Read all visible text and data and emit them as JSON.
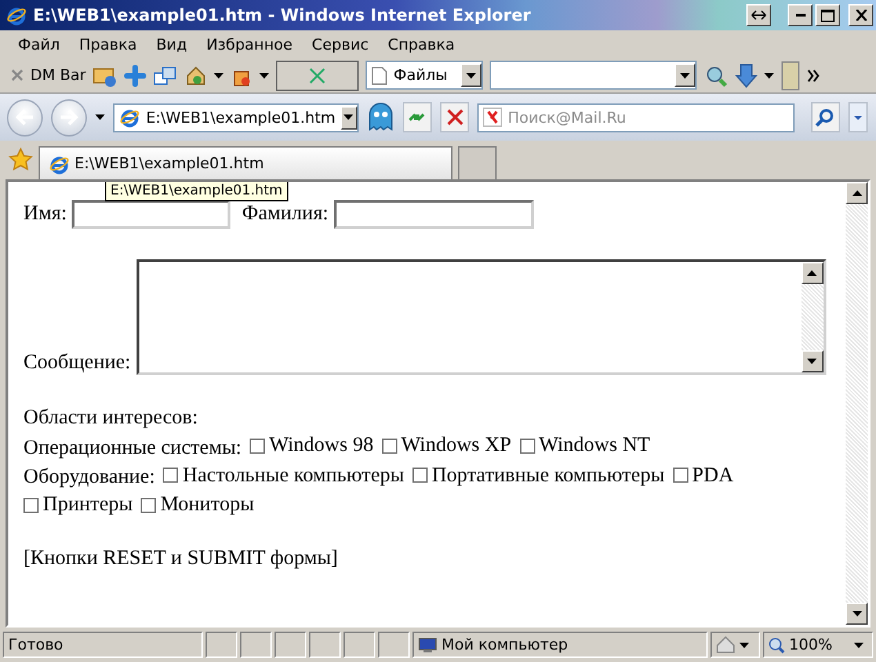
{
  "window": {
    "title": "E:\\WEB1\\example01.htm - Windows Internet Explorer"
  },
  "menu": [
    {
      "label": "Файл"
    },
    {
      "label": "Правка"
    },
    {
      "label": "Вид"
    },
    {
      "label": "Избранное"
    },
    {
      "label": "Сервис"
    },
    {
      "label": "Справка"
    }
  ],
  "toolbar": {
    "dm_bar": "DM Bar",
    "files_dropdown": "Файлы"
  },
  "address_bar": {
    "value": "E:\\WEB1\\example01.htm"
  },
  "search": {
    "placeholder": "Поиск@Mail.Ru"
  },
  "tabs": [
    {
      "label": "E:\\WEB1\\example01.htm",
      "selected": true
    }
  ],
  "page": {
    "name_label": "Имя:",
    "surname_label": "Фамилия:",
    "message_label": "Сообщение:",
    "interests_heading": "Области интересов:",
    "groups": [
      {
        "label": "Операционные системы:",
        "options": [
          {
            "label": "Windows 98",
            "checked": false
          },
          {
            "label": "Windows XP",
            "checked": false
          },
          {
            "label": "Windows NT",
            "checked": false
          }
        ]
      },
      {
        "label": "Оборудование:",
        "options": [
          {
            "label": "Настольные компьютеры",
            "checked": false
          },
          {
            "label": "Портативные компьютеры",
            "checked": false
          },
          {
            "label": "PDA",
            "checked": false
          },
          {
            "label": "Принтеры",
            "checked": false
          },
          {
            "label": "Мониторы",
            "checked": false
          }
        ]
      }
    ],
    "note": "[Кнопки RESET и SUBMIT формы]"
  },
  "tooltip": "E:\\WEB1\\example01.htm",
  "status_bar": {
    "text": "Готово",
    "zone": "Мой компьютер",
    "zoom": "100%"
  }
}
